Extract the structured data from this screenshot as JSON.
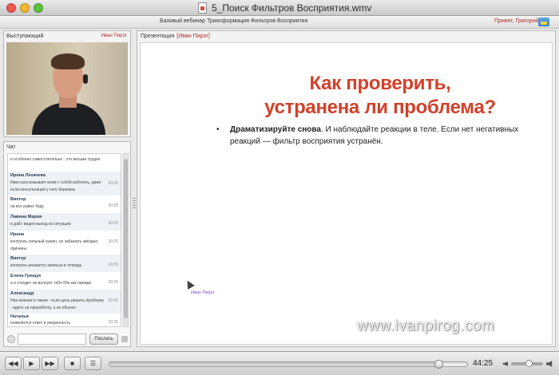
{
  "window": {
    "title": "5_Поиск Фильтров Восприятия.wmv"
  },
  "app_header": {
    "webinar_title": "Базовый вебинар Трансформация Фильтров Восприятия",
    "greeting": "Привет, Григорий"
  },
  "presenter": {
    "label": "Выступающий",
    "name": "Иван Пирог"
  },
  "chat": {
    "label": "Чат",
    "messages": [
      {
        "author": "",
        "text": "и особенно самостоятельно - это весьма трудно",
        "time": ""
      },
      {
        "author": "Ирина Лехачева",
        "text": "Иван рассказывает всем с собой работать, даже если консультации у него бережны",
        "time": "20:25"
      },
      {
        "author": "Виктор",
        "text": "на все равно буду",
        "time": "20:25"
      },
      {
        "author": "Лавина Мария",
        "text": "и даЁт видеи выход из ситуации",
        "time": "20:25"
      },
      {
        "author": "Ирина",
        "text": "контроль сильный нужен, не забывать звёздно, причины",
        "time": "20:25"
      },
      {
        "author": "Виктор",
        "text": "контроль решается записью в тетрадь",
        "time": "20:25"
      },
      {
        "author": "Елена Грищук",
        "text": "а я отходит не волнует тебя ббк как прежде",
        "time": "20:25"
      },
      {
        "author": "Александр",
        "text": "Нов мнение в таком - если цель решить проблему - идите на проработку, а не обычно",
        "time": "20:25"
      },
      {
        "author": "Наталья",
        "text": "появляется ответ и уверенность",
        "time": "20:25"
      }
    ],
    "input_placeholder": "",
    "send_label": "Послать"
  },
  "presentation": {
    "label": "Презентация",
    "presenter_tag": "[Иван Пирог]",
    "slide": {
      "title_line1": "Как проверить,",
      "title_line2": "устранена ли проблема?",
      "bullet_bold": "Драматизируйте снова",
      "bullet_rest": ". И наблюдайте реакции в теле. Если нет негативных реакций — фильтр восприятия устранён.",
      "pointer_name": "Иван Пирог"
    }
  },
  "watermark": "www.ivanpirog.com",
  "player": {
    "time": "44:25",
    "progress": 0.92,
    "volume": 0.55,
    "icons": {
      "rewind": "rewind-icon",
      "play": "play-icon",
      "forward": "fast-forward-icon",
      "stop": "stop-icon",
      "playlist": "playlist-icon"
    }
  },
  "colors": {
    "accent_red": "#d2402a",
    "name_red": "#b02a2a",
    "pointer_purple": "#7b4cc7"
  }
}
